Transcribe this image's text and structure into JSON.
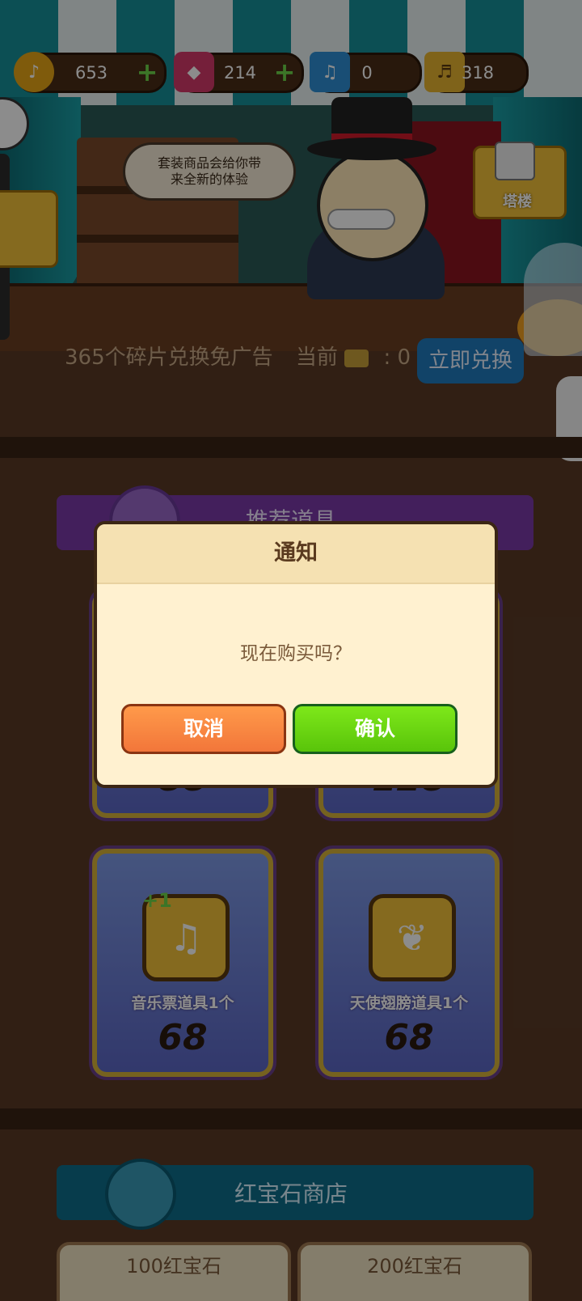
{
  "currency": {
    "coins": "653",
    "rubies": "214",
    "music_tickets": "0",
    "fragments": "318"
  },
  "shopkeeper_bubble": {
    "line1": "套装商品会给你带",
    "line2": "来全新的体验"
  },
  "tower_label": "塔楼",
  "exchange": {
    "text": "365个碎片兑换免广告",
    "current_label": "当前",
    "current_value": ":  0",
    "button_label": "立即兑换"
  },
  "recommended_banner": "推荐道具",
  "items": [
    {
      "name": "",
      "price": "88"
    },
    {
      "name": "",
      "price": "128"
    },
    {
      "name": "音乐票道具1个",
      "price": "68",
      "badge": "+1"
    },
    {
      "name": "天使翅膀道具1个",
      "price": "68"
    }
  ],
  "ruby_shop": {
    "title": "红宝石商店",
    "packs": [
      "100红宝石",
      "200红宝石"
    ]
  },
  "dialog": {
    "title": "通知",
    "message": "现在购买吗？",
    "cancel_label": "取消",
    "confirm_label": "确认"
  },
  "colors": {
    "confirm": "#59c40a",
    "cancel": "#f2763a",
    "dialog_bg": "#fff1d0"
  }
}
